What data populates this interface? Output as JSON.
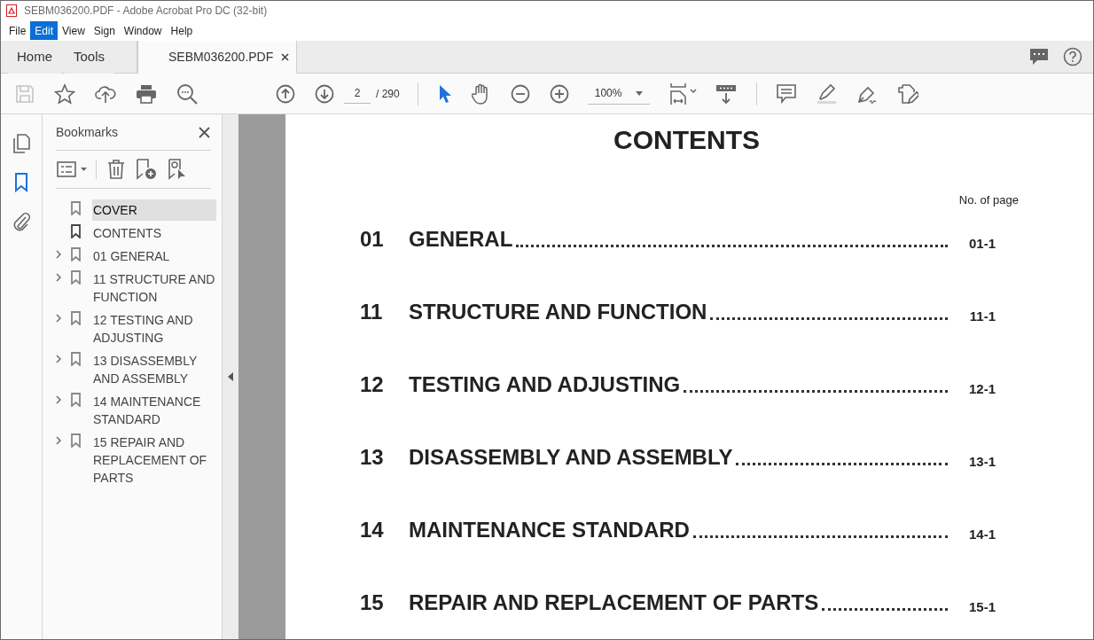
{
  "window": {
    "title": "SEBM036200.PDF - Adobe Acrobat Pro DC (32-bit)"
  },
  "menu": [
    {
      "label": "File",
      "selected": false
    },
    {
      "label": "Edit",
      "selected": true
    },
    {
      "label": "View",
      "selected": false
    },
    {
      "label": "Sign",
      "selected": false
    },
    {
      "label": "Window",
      "selected": false
    },
    {
      "label": "Help",
      "selected": false
    }
  ],
  "tabs": [
    {
      "label": "Home",
      "selected": false,
      "kind": "nav"
    },
    {
      "label": "Tools",
      "selected": false,
      "kind": "nav"
    },
    {
      "label": "SEBM036200.PDF",
      "selected": true,
      "kind": "document"
    }
  ],
  "toolbar": {
    "page": "2",
    "page_total": "/ 290",
    "zoom": "100%"
  },
  "bookmarks": {
    "title": "Bookmarks",
    "items": [
      {
        "label": "COVER",
        "selected": true,
        "expandable": false,
        "current": false
      },
      {
        "label": "CONTENTS",
        "selected": false,
        "expandable": false,
        "current": true
      },
      {
        "label": "01 GENERAL",
        "selected": false,
        "expandable": true,
        "current": false
      },
      {
        "label": "11 STRUCTURE AND FUNCTION",
        "selected": false,
        "expandable": true,
        "current": false
      },
      {
        "label": "12 TESTING AND ADJUSTING",
        "selected": false,
        "expandable": true,
        "current": false
      },
      {
        "label": "13 DISASSEMBLY AND ASSEMBLY",
        "selected": false,
        "expandable": true,
        "current": false
      },
      {
        "label": "14 MAINTENANCE STANDARD",
        "selected": false,
        "expandable": true,
        "current": false
      },
      {
        "label": "15 REPAIR AND REPLACEMENT OF PARTS",
        "selected": false,
        "expandable": true,
        "current": false
      }
    ]
  },
  "document": {
    "heading": "CONTENTS",
    "page_column_label": "No. of page",
    "entries": [
      {
        "number": "01",
        "title": "GENERAL",
        "page": "01-1"
      },
      {
        "number": "11",
        "title": "STRUCTURE AND FUNCTION",
        "page": "11-1"
      },
      {
        "number": "12",
        "title": "TESTING AND ADJUSTING",
        "page": "12-1"
      },
      {
        "number": "13",
        "title": "DISASSEMBLY AND ASSEMBLY",
        "page": "13-1"
      },
      {
        "number": "14",
        "title": "MAINTENANCE STANDARD",
        "page": "14-1"
      },
      {
        "number": "15",
        "title": "REPAIR AND REPLACEMENT OF PARTS",
        "page": "15-1"
      }
    ]
  }
}
